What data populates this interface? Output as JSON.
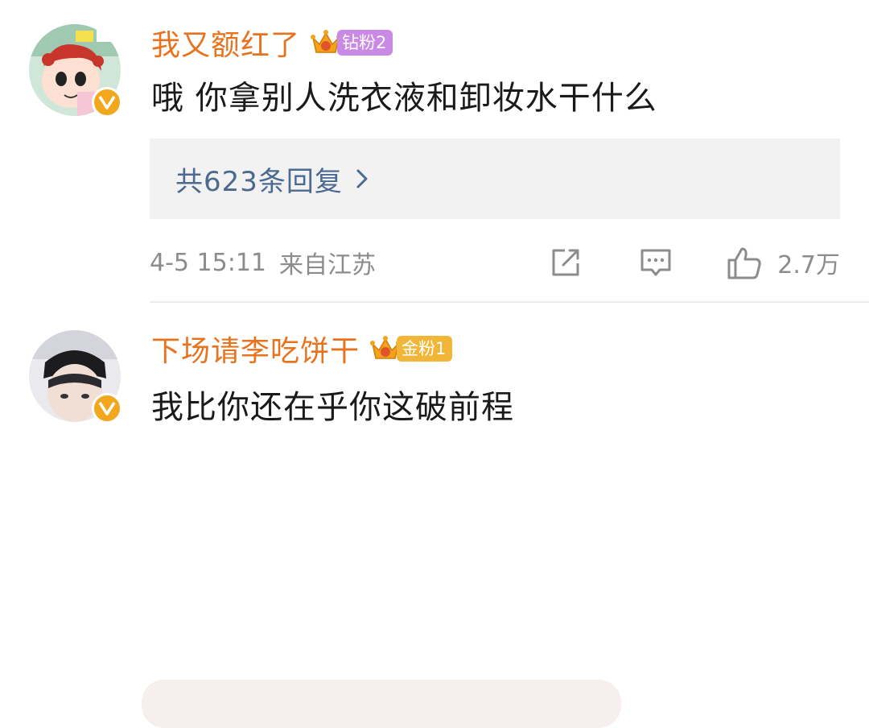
{
  "comments": [
    {
      "username": "我又额红了",
      "fan_badge": {
        "label": "钻粉2",
        "level": "7",
        "color": "#c98ae6"
      },
      "text": "哦 你拿别人洗衣液和卸妆水干什么",
      "replies_label": "共623条回复",
      "timestamp": "4-5 15:11",
      "location": "来自江苏",
      "likes": "2.7万"
    },
    {
      "username": "下场请李吃饼干",
      "fan_badge": {
        "label": "金粉1",
        "level": "6",
        "color": "#f1b638"
      },
      "text": "我比你还在乎你这破前程"
    }
  ],
  "icons": {
    "share": "share-icon",
    "comment": "comment-icon",
    "like": "thumbs-up-icon",
    "chevron": "chevron-right-icon",
    "verified": "verified-v-icon",
    "crown": "crown-icon"
  },
  "colors": {
    "username": "#e8731f",
    "reply_link": "#4a6a8f",
    "meta": "#8c8c8c",
    "verified": "#f2a81d"
  }
}
